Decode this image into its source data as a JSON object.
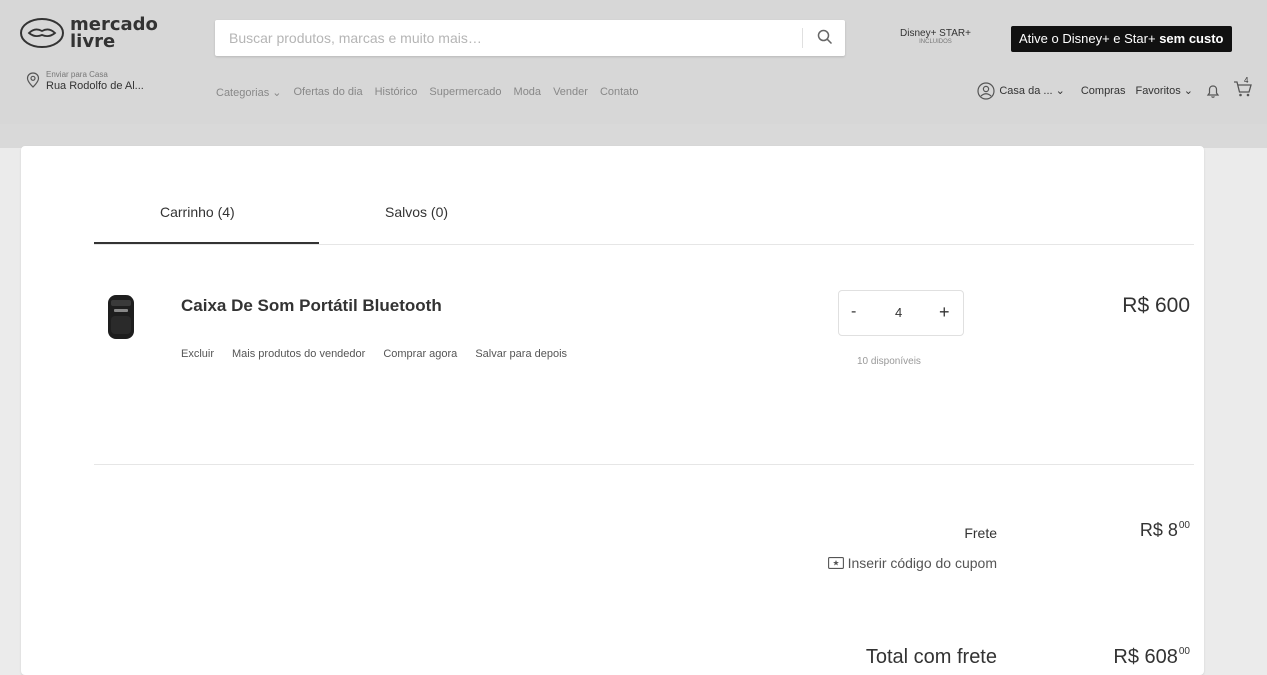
{
  "header": {
    "logo_line1": "mercado",
    "logo_line2": "livre",
    "search_placeholder": "Buscar produtos, marcas e muito mais…",
    "disney_logo_text": "Disney+ STAR+",
    "disney_logo_small": "INCLUIDOS",
    "promo_text": "Ative o Disney+ e Star+ ",
    "promo_bold": "sem custo",
    "location_small": "Enviar para Casa",
    "location_main": "Rua Rodolfo de Al...",
    "nav": [
      "Categorias",
      "Ofertas do dia",
      "Histórico",
      "Supermercado",
      "Moda",
      "Vender",
      "Contato"
    ],
    "user_name": "Casa da ...",
    "compras": "Compras",
    "favoritos": "Favoritos",
    "cart_count": "4"
  },
  "tabs": {
    "carrinho": "Carrinho (4)",
    "salvos": "Salvos (0)"
  },
  "item": {
    "title": "Caixa De Som Portátil Bluetooth",
    "actions": [
      "Excluir",
      "Mais produtos do vendedor",
      "Comprar agora",
      "Salvar para depois"
    ],
    "qty_minus": "-",
    "qty_value": "4",
    "qty_plus": "+",
    "available": "10 disponíveis",
    "price": "R$ 600"
  },
  "summary": {
    "frete_label": "Frete",
    "frete_price": "R$ 8",
    "frete_cents": "00",
    "coupon": "Inserir código do cupom",
    "total_label": "Total com frete",
    "total_price": "R$ 608",
    "total_cents": "00"
  }
}
